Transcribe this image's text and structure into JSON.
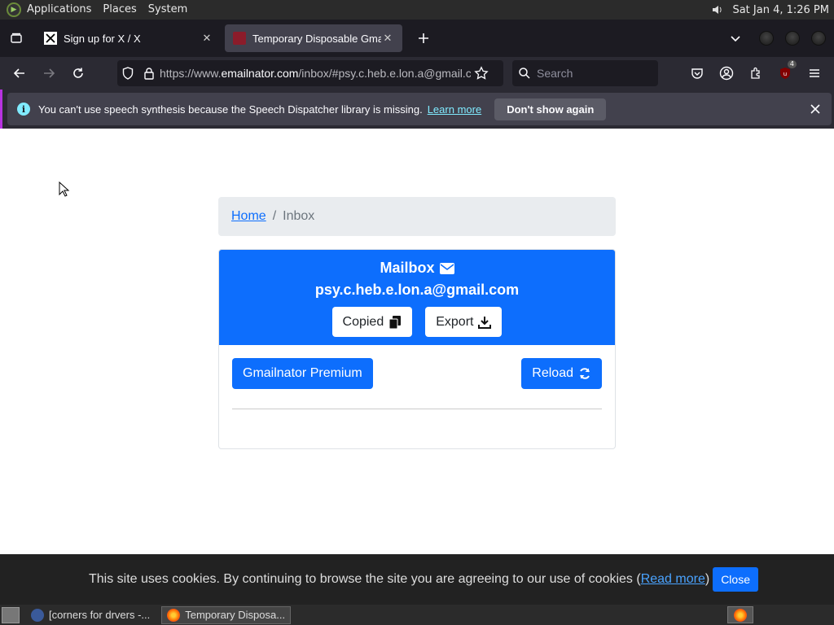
{
  "top_panel": {
    "menus": [
      "Applications",
      "Places",
      "System"
    ],
    "clock": "Sat Jan  4,  1:26 PM"
  },
  "tabs": [
    {
      "label": "Sign up for X / X",
      "favicon": "x-logo-icon",
      "active": false
    },
    {
      "label": "Temporary Disposable Gmail",
      "favicon": "emailnator-icon",
      "active": true
    }
  ],
  "navbar": {
    "url_prefix": "https://www.",
    "url_host": "emailnator.com",
    "url_rest": "/inbox/#psy.c.heb.e.lon.a@gmail.com",
    "search_placeholder": "Search",
    "extensions_badge": "4"
  },
  "notification": {
    "message": "You can't use speech synthesis because the Speech Dispatcher library is missing.",
    "learn_more": "Learn more",
    "dont_show": "Don't show again"
  },
  "breadcrumb": {
    "home": "Home",
    "separator": "/",
    "current": "Inbox"
  },
  "mailbox": {
    "title": "Mailbox",
    "email": "psy.c.heb.e.lon.a@gmail.com",
    "copied_label": "Copied",
    "export_label": "Export",
    "premium_label": "Gmailnator Premium",
    "reload_label": "Reload"
  },
  "cookie_bar": {
    "text": "This site uses cookies. By continuing to browse the site you are agreeing to our use of cookies (",
    "read_more": "Read more",
    "close_paren": ")",
    "close_label": "Close"
  },
  "taskbar": {
    "tasks": [
      {
        "label": "[corners for drvers -...",
        "active": false
      },
      {
        "label": "Temporary Disposa...",
        "active": true
      }
    ]
  },
  "colors": {
    "primary": "#0d6efd",
    "browser_bg": "#2b2a33",
    "tabbar_bg": "#1c1b22",
    "cookie_bg": "#222222"
  }
}
